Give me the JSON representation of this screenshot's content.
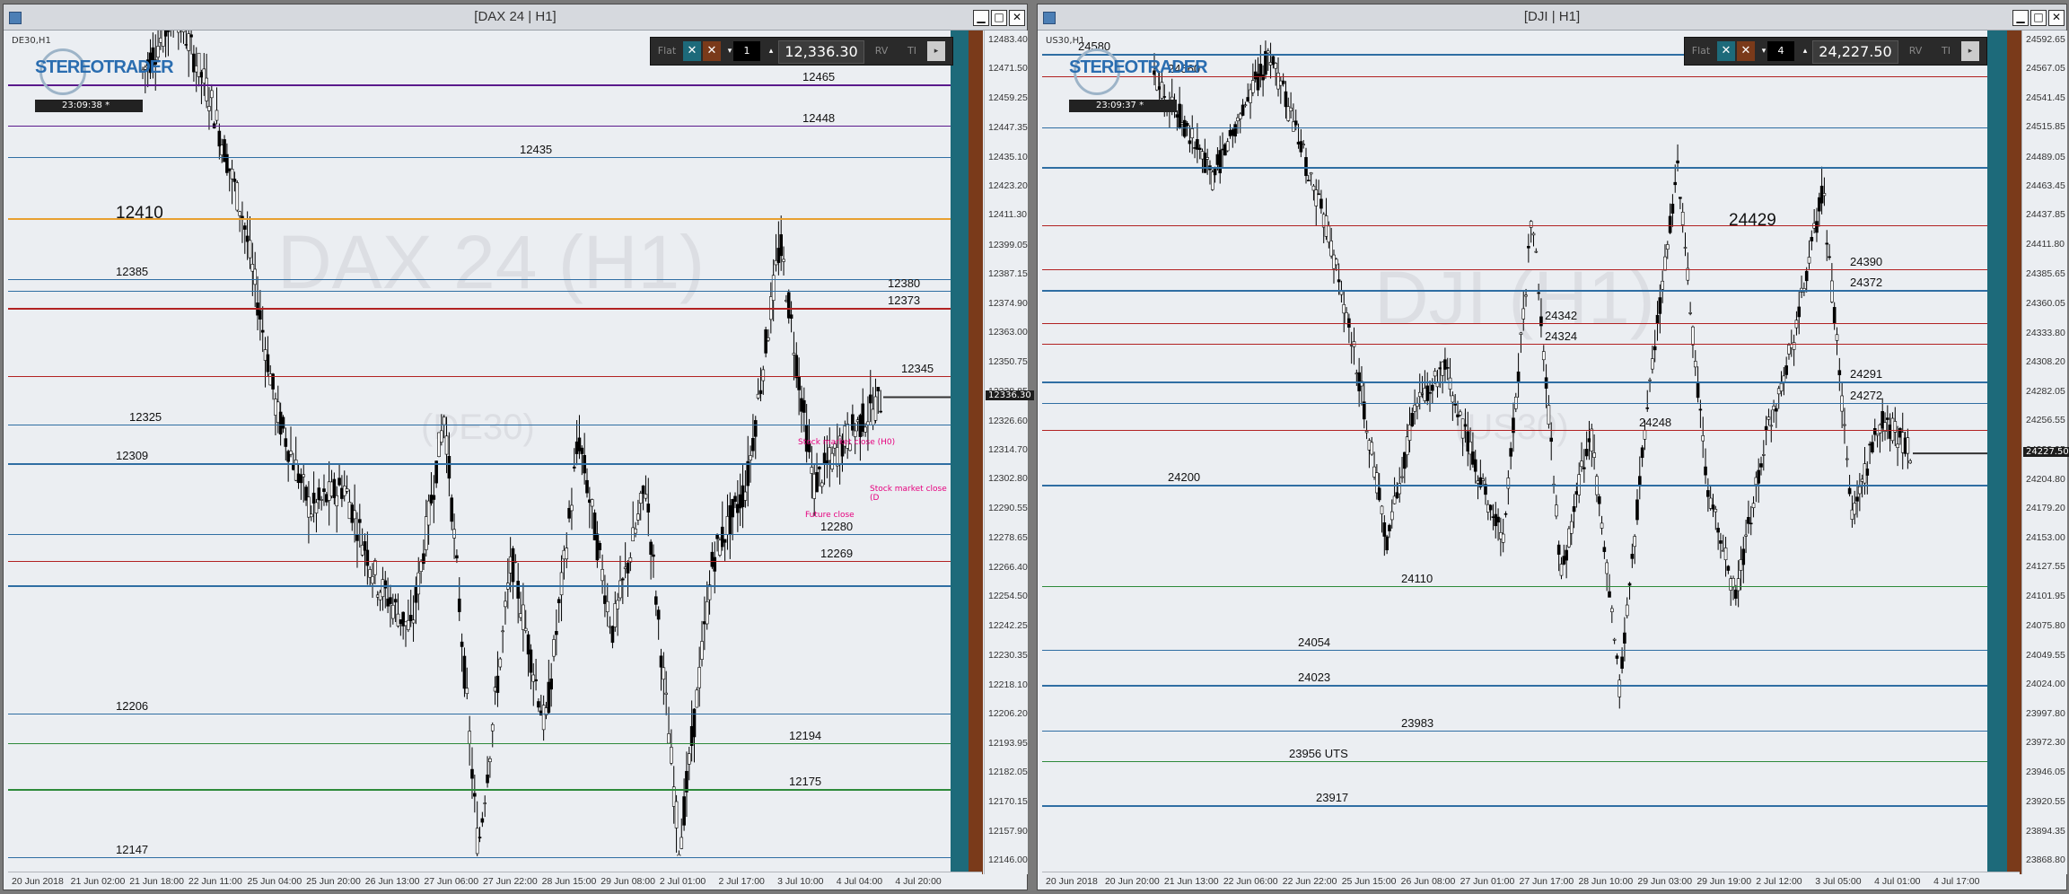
{
  "colors": {
    "background": "#ebeef2",
    "red_level": "#b22222",
    "blue_level": "#2f6ea3",
    "green_level": "#2d8a3a",
    "purple_level": "#5a1a8c",
    "orange_level": "#e8a030",
    "candle": "#000000",
    "toolbar": "#2a2a2a",
    "sidebar_teal": "#1d6a7a",
    "sidebar_brown": "#7a3a1a"
  },
  "toolbar_common": {
    "flat_label": "Flat",
    "close_icon": "close-icon",
    "rv_label": "RV",
    "ti_label": "TI",
    "logo_text": "STEREOTRADER"
  },
  "left": {
    "title": "[DAX 24 | H1]",
    "symbol": "DE30,H1",
    "clock": "23:09:38 *",
    "lots": "1",
    "price_display": "12,336.30",
    "watermark_main": "DAX 24 (H1)",
    "watermark_sub": "(DE30)",
    "price_ticks": [
      {
        "v": 12483.4,
        "t": "12483.40"
      },
      {
        "v": 12471.5,
        "t": "12471.50"
      },
      {
        "v": 12459.25,
        "t": "12459.25"
      },
      {
        "v": 12447.35,
        "t": "12447.35"
      },
      {
        "v": 12435.1,
        "t": "12435.10"
      },
      {
        "v": 12423.2,
        "t": "12423.20"
      },
      {
        "v": 12411.3,
        "t": "12411.30"
      },
      {
        "v": 12399.05,
        "t": "12399.05"
      },
      {
        "v": 12387.15,
        "t": "12387.15"
      },
      {
        "v": 12374.9,
        "t": "12374.90"
      },
      {
        "v": 12363.0,
        "t": "12363.00"
      },
      {
        "v": 12350.75,
        "t": "12350.75"
      },
      {
        "v": 12338.85,
        "t": "12338.85"
      },
      {
        "v": 12326.6,
        "t": "12326.60"
      },
      {
        "v": 12314.7,
        "t": "12314.70"
      },
      {
        "v": 12302.8,
        "t": "12302.80"
      },
      {
        "v": 12290.55,
        "t": "12290.55"
      },
      {
        "v": 12278.65,
        "t": "12278.65"
      },
      {
        "v": 12266.4,
        "t": "12266.40"
      },
      {
        "v": 12254.5,
        "t": "12254.50"
      },
      {
        "v": 12242.25,
        "t": "12242.25"
      },
      {
        "v": 12230.35,
        "t": "12230.35"
      },
      {
        "v": 12218.1,
        "t": "12218.10"
      },
      {
        "v": 12206.2,
        "t": "12206.20"
      },
      {
        "v": 12193.95,
        "t": "12193.95"
      },
      {
        "v": 12182.05,
        "t": "12182.05"
      },
      {
        "v": 12170.15,
        "t": "12170.15"
      },
      {
        "v": 12157.9,
        "t": "12157.90"
      },
      {
        "v": 12146.0,
        "t": "12146.00"
      }
    ],
    "price_tag": {
      "v": 12336.3,
      "t": "12336.30"
    },
    "time_ticks": [
      "20 Jun 2018",
      "21 Jun 02:00",
      "21 Jun 18:00",
      "22 Jun 11:00",
      "25 Jun 04:00",
      "25 Jun 20:00",
      "26 Jun 13:00",
      "27 Jun 06:00",
      "27 Jun 22:00",
      "28 Jun 15:00",
      "29 Jun 08:00",
      "2 Jul 01:00",
      "2 Jul 17:00",
      "3 Jul 10:00",
      "4 Jul 04:00",
      "4 Jul 20:00"
    ],
    "levels": [
      {
        "v": 12465,
        "c": "#5a1a8c",
        "label": "12465"
      },
      {
        "v": 12448,
        "c": "#5a1a8c",
        "label": "12448"
      },
      {
        "v": 12435,
        "c": "#2f6ea3",
        "label": "12435"
      },
      {
        "v": 12410,
        "c": "#e8a030",
        "label": "12410"
      },
      {
        "v": 12385,
        "c": "#2f6ea3",
        "label": "12385"
      },
      {
        "v": 12380,
        "c": "#2f6ea3",
        "label": "12380"
      },
      {
        "v": 12373,
        "c": "#b22222",
        "label": "12373"
      },
      {
        "v": 12345,
        "c": "#b22222",
        "label": "12345"
      },
      {
        "v": 12325,
        "c": "#2f6ea3",
        "label": "12325"
      },
      {
        "v": 12309,
        "c": "#2f6ea3",
        "label": "12309"
      },
      {
        "v": 12280,
        "c": "#2f6ea3",
        "label": "12280"
      },
      {
        "v": 12269,
        "c": "#b22222",
        "label": "12269"
      },
      {
        "v": 12259,
        "c": "#2f6ea3",
        "label": ""
      },
      {
        "v": 12206,
        "c": "#2f6ea3",
        "label": "12206"
      },
      {
        "v": 12194,
        "c": "#2d8a3a",
        "label": "12194"
      },
      {
        "v": 12175,
        "c": "#2d8a3a",
        "label": "12175"
      },
      {
        "v": 12147,
        "c": "#2f6ea3",
        "label": "12147"
      }
    ],
    "annotations": [
      "Stock market close (H0)",
      "Future close",
      "Stock market close (D"
    ]
  },
  "right": {
    "title": "[DJI | H1]",
    "symbol": "US30,H1",
    "clock": "23:09:37 *",
    "lots": "4",
    "price_display": "24,227.50",
    "watermark_main": "DJI (H1)",
    "watermark_sub": "(US30)",
    "price_ticks": [
      {
        "v": 24592.65,
        "t": "24592.65"
      },
      {
        "v": 24567.05,
        "t": "24567.05"
      },
      {
        "v": 24541.45,
        "t": "24541.45"
      },
      {
        "v": 24515.85,
        "t": "24515.85"
      },
      {
        "v": 24489.05,
        "t": "24489.05"
      },
      {
        "v": 24463.45,
        "t": "24463.45"
      },
      {
        "v": 24437.85,
        "t": "24437.85"
      },
      {
        "v": 24411.8,
        "t": "24411.80"
      },
      {
        "v": 24385.65,
        "t": "24385.65"
      },
      {
        "v": 24360.05,
        "t": "24360.05"
      },
      {
        "v": 24333.8,
        "t": "24333.80"
      },
      {
        "v": 24308.2,
        "t": "24308.20"
      },
      {
        "v": 24282.05,
        "t": "24282.05"
      },
      {
        "v": 24256.55,
        "t": "24256.55"
      },
      {
        "v": 24230.95,
        "t": "24230.95"
      },
      {
        "v": 24204.8,
        "t": "24204.80"
      },
      {
        "v": 24179.2,
        "t": "24179.20"
      },
      {
        "v": 24153.0,
        "t": "24153.00"
      },
      {
        "v": 24127.55,
        "t": "24127.55"
      },
      {
        "v": 24101.95,
        "t": "24101.95"
      },
      {
        "v": 24075.8,
        "t": "24075.80"
      },
      {
        "v": 24049.55,
        "t": "24049.55"
      },
      {
        "v": 24024.0,
        "t": "24024.00"
      },
      {
        "v": 23997.8,
        "t": "23997.80"
      },
      {
        "v": 23972.3,
        "t": "23972.30"
      },
      {
        "v": 23946.05,
        "t": "23946.05"
      },
      {
        "v": 23920.55,
        "t": "23920.55"
      },
      {
        "v": 23894.35,
        "t": "23894.35"
      },
      {
        "v": 23868.8,
        "t": "23868.80"
      }
    ],
    "price_tag": {
      "v": 24227.5,
      "t": "24227.50"
    },
    "time_ticks": [
      "20 Jun 2018",
      "20 Jun 20:00",
      "21 Jun 13:00",
      "22 Jun 06:00",
      "22 Jun 22:00",
      "25 Jun 15:00",
      "26 Jun 08:00",
      "27 Jun 01:00",
      "27 Jun 17:00",
      "28 Jun 10:00",
      "29 Jun 03:00",
      "29 Jun 19:00",
      "2 Jul 12:00",
      "3 Jul 05:00",
      "4 Jul 01:00",
      "4 Jul 17:00"
    ],
    "levels": [
      {
        "v": 24580,
        "c": "#2f6ea3",
        "label": "24580"
      },
      {
        "v": 24560,
        "c": "#b22222",
        "label": "24560"
      },
      {
        "v": 24515,
        "c": "#2f6ea3",
        "label": ""
      },
      {
        "v": 24480,
        "c": "#2f6ea3",
        "label": ""
      },
      {
        "v": 24429,
        "c": "#b22222",
        "label": "24429"
      },
      {
        "v": 24390,
        "c": "#b22222",
        "label": "24390"
      },
      {
        "v": 24372,
        "c": "#2f6ea3",
        "label": "24372"
      },
      {
        "v": 24342,
        "c": "#b22222",
        "label": "24342"
      },
      {
        "v": 24324,
        "c": "#b22222",
        "label": "24324"
      },
      {
        "v": 24291,
        "c": "#2f6ea3",
        "label": "24291"
      },
      {
        "v": 24272,
        "c": "#2f6ea3",
        "label": "24272"
      },
      {
        "v": 24248,
        "c": "#b22222",
        "label": "24248"
      },
      {
        "v": 24200,
        "c": "#2f6ea3",
        "label": "24200"
      },
      {
        "v": 24110,
        "c": "#2d8a3a",
        "label": "24110"
      },
      {
        "v": 24054,
        "c": "#2f6ea3",
        "label": "24054"
      },
      {
        "v": 24023,
        "c": "#2f6ea3",
        "label": "24023"
      },
      {
        "v": 23983,
        "c": "#2f6ea3",
        "label": "23983"
      },
      {
        "v": 23956,
        "c": "#2d8a3a",
        "label": "23956 UTS"
      },
      {
        "v": 23917,
        "c": "#2f6ea3",
        "label": "23917"
      }
    ]
  }
}
